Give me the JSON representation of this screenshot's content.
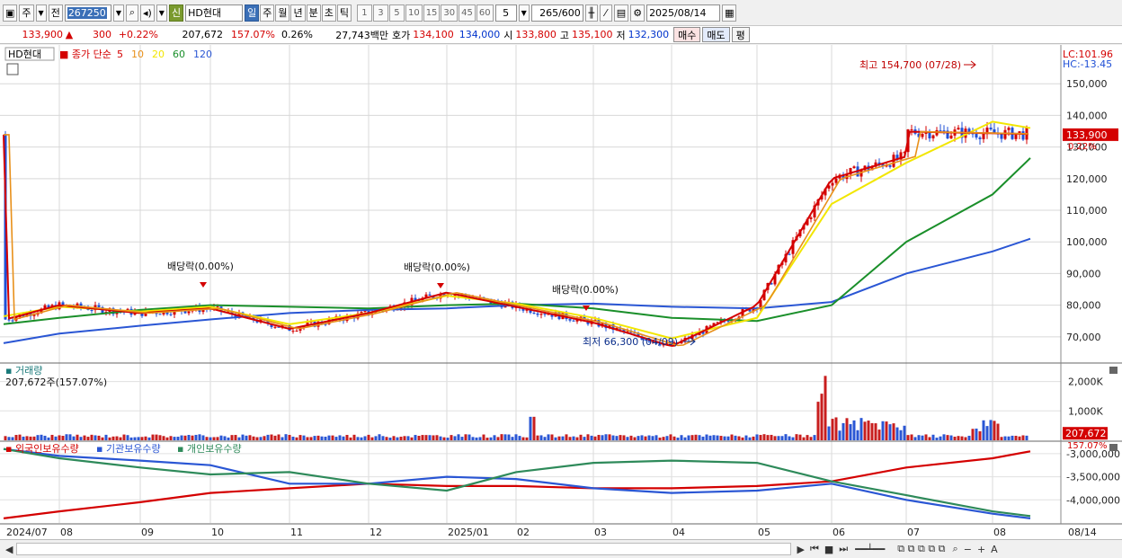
{
  "toolbar": {
    "period_label": "주",
    "prev_label": "전",
    "code": "267250",
    "sin_badge": "신",
    "stock_name": "HD현대",
    "tabs": [
      "일",
      "주",
      "월",
      "년",
      "분",
      "초",
      "틱"
    ],
    "active_tab": "일",
    "intervals": [
      "1",
      "3",
      "5",
      "10",
      "15",
      "30",
      "45",
      "60"
    ],
    "interval_value": "5",
    "count_value": "265",
    "count_max": "/600",
    "date": "2025/08/14"
  },
  "quote": {
    "price": "133,900",
    "arrow": "▲",
    "change": "300",
    "change_pct": "+0.22%",
    "volume": "207,672",
    "volume_pct": "157.07%",
    "turnover_pct": "0.26%",
    "amount": "27,743백만",
    "hoga_label": "호가",
    "ask": "134,100",
    "bid": "134,000",
    "open_label": "시",
    "open": "133,800",
    "high_label": "고",
    "high": "135,100",
    "low_label": "저",
    "low": "132,300",
    "buy_label": "매수",
    "sell_label": "매도",
    "eval_label": "평"
  },
  "chart_data": [
    {
      "type": "candlestick",
      "pane": "price",
      "title": "HD현대",
      "legend": {
        "label": "종가 단순",
        "periods": [
          "5",
          "10",
          "20",
          "60",
          "120"
        ],
        "colors": [
          "#d40000",
          "#e8901a",
          "#f2e600",
          "#1a8f2a",
          "#2a56d4"
        ]
      },
      "x_ticks": [
        "2024/07",
        "08",
        "09",
        "10",
        "11",
        "12",
        "2025/01",
        "02",
        "03",
        "04",
        "05",
        "06",
        "07",
        "08",
        "08/14"
      ],
      "y_ticks": [
        "70,000",
        "80,000",
        "90,000",
        "100,000",
        "110,000",
        "120,000",
        "130,000",
        "140,000",
        "150,000"
      ],
      "ylim": [
        62000,
        160000
      ],
      "close_points": [
        {
          "x": "2024/07",
          "y": 75500
        },
        {
          "x": "08",
          "y": 80000
        },
        {
          "x": "09",
          "y": 77500
        },
        {
          "x": "10",
          "y": 79000
        },
        {
          "x": "11",
          "y": 72500
        },
        {
          "x": "12",
          "y": 77500
        },
        {
          "x": "2025/01",
          "y": 84000
        },
        {
          "x": "02",
          "y": 79500
        },
        {
          "x": "03",
          "y": 74500
        },
        {
          "x": "04",
          "y": 67000
        },
        {
          "x": "05",
          "y": 80000
        },
        {
          "x": "06",
          "y": 120000
        },
        {
          "x": "07",
          "y": 127000
        },
        {
          "x": "08",
          "y": 140000
        },
        {
          "x": "08/14",
          "y": 133900
        }
      ],
      "ma_series": [
        {
          "name": "120",
          "values": [
            68000,
            71000,
            73500,
            75500,
            77500,
            78500,
            79000,
            80000,
            80500,
            79500,
            79000,
            81000,
            90000,
            97000,
            101000
          ]
        },
        {
          "name": "60",
          "values": [
            74000,
            76000,
            78500,
            80000,
            79500,
            79000,
            80000,
            80500,
            79000,
            76000,
            75000,
            80000,
            100000,
            115000,
            126500
          ]
        },
        {
          "name": "20",
          "values": [
            76500,
            79500,
            78000,
            79500,
            74000,
            77500,
            83000,
            80500,
            76000,
            69500,
            76000,
            112000,
            125000,
            138000,
            136000
          ]
        }
      ],
      "current_price_label": "133,900",
      "current_pct_label": "0.22%",
      "lc_label": "LC:101.96",
      "hc_label": "HC:-13.45",
      "annotations": {
        "high": "최고 154,700 (07/28)",
        "low": "최저 66,300 (04/09)",
        "dividends": [
          "배당락(0.00%)",
          "배당락(0.00%)",
          "배당락(0.00%)"
        ]
      }
    },
    {
      "type": "bar",
      "pane": "volume",
      "title": "거래량",
      "subtitle": "207,672주(157.07%)",
      "y_ticks": [
        "1,000K",
        "2,000K"
      ],
      "current_label": "207,672",
      "current_pct_label": "157.07%",
      "peaks": [
        {
          "x": "06",
          "y": 2200000
        },
        {
          "x": "02",
          "y": 800000
        },
        {
          "x": "08",
          "y": 700000
        }
      ]
    },
    {
      "type": "line",
      "pane": "holdings",
      "series": [
        {
          "name": "외국인보유수량",
          "color": "#d40000"
        },
        {
          "name": "기관보유수량",
          "color": "#2a56d4"
        },
        {
          "name": "개인보유수량",
          "color": "#2e8a5a"
        }
      ],
      "y_ticks": [
        "-3,000,000",
        "-3,500,000",
        "-4,000,000"
      ]
    }
  ]
}
